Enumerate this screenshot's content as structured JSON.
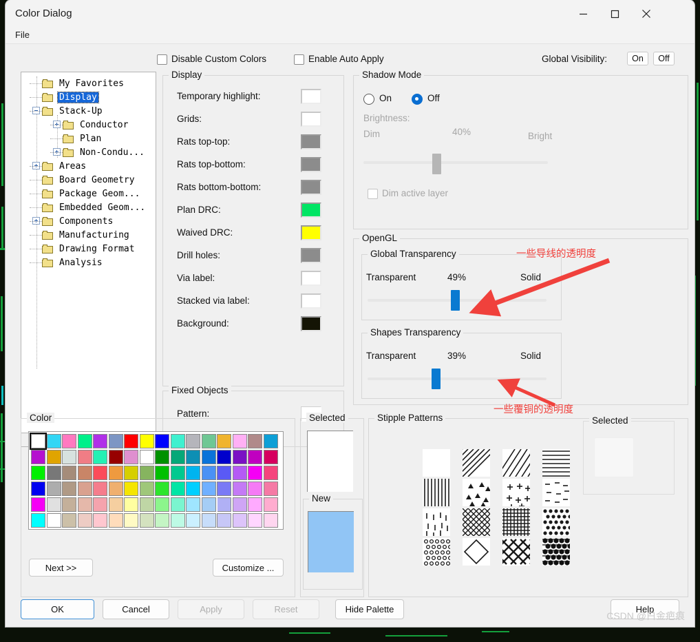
{
  "window": {
    "title": "Color Dialog",
    "controls": {
      "minimize": "minimize-icon",
      "maximize": "maximize-icon",
      "close": "close-icon"
    },
    "menu": [
      "File"
    ]
  },
  "top_options": {
    "disable_custom_colors": {
      "label": "Disable Custom Colors",
      "checked": false
    },
    "enable_auto_apply": {
      "label": "Enable Auto Apply",
      "checked": false
    },
    "global_visibility": {
      "label": "Global Visibility:",
      "on": "On",
      "off": "Off"
    }
  },
  "tree": {
    "items": [
      {
        "label": "My Favorites",
        "indent": 1,
        "expander": "",
        "selected": false
      },
      {
        "label": "Display",
        "indent": 1,
        "expander": "",
        "selected": true
      },
      {
        "label": "Stack-Up",
        "indent": 1,
        "expander": "minus",
        "selected": false
      },
      {
        "label": "Conductor",
        "indent": 2,
        "expander": "plus",
        "selected": false
      },
      {
        "label": "Plan",
        "indent": 2,
        "expander": "",
        "selected": false
      },
      {
        "label": "Non-Condu...",
        "indent": 2,
        "expander": "plus",
        "selected": false
      },
      {
        "label": "Areas",
        "indent": 1,
        "expander": "plus",
        "selected": false
      },
      {
        "label": "Board Geometry",
        "indent": 1,
        "expander": "",
        "selected": false
      },
      {
        "label": "Package Geom...",
        "indent": 1,
        "expander": "",
        "selected": false
      },
      {
        "label": "Embedded Geom...",
        "indent": 1,
        "expander": "",
        "selected": false
      },
      {
        "label": "Components",
        "indent": 1,
        "expander": "plus",
        "selected": false
      },
      {
        "label": "Manufacturing",
        "indent": 1,
        "expander": "",
        "selected": false
      },
      {
        "label": "Drawing Format",
        "indent": 1,
        "expander": "",
        "selected": false
      },
      {
        "label": "Analysis",
        "indent": 1,
        "expander": "",
        "selected": false
      }
    ]
  },
  "display_group": {
    "legend": "Display",
    "rows": [
      {
        "label": "Temporary highlight:",
        "color": "#ffffff"
      },
      {
        "label": "Grids:",
        "color": "#ffffff"
      },
      {
        "label": "Rats top-top:",
        "color": "#8c8c8c"
      },
      {
        "label": "Rats top-bottom:",
        "color": "#8c8c8c"
      },
      {
        "label": "Rats bottom-bottom:",
        "color": "#8c8c8c"
      },
      {
        "label": "Plan DRC:",
        "color": "#00e564"
      },
      {
        "label": "Waived DRC:",
        "color": "#ffff00"
      },
      {
        "label": "Drill holes:",
        "color": "#8c8c8c"
      },
      {
        "label": "Via label:",
        "color": "#ffffff"
      },
      {
        "label": "Stacked via label:",
        "color": "#ffffff"
      },
      {
        "label": "Background:",
        "color": "#141405"
      }
    ]
  },
  "fixed_objects": {
    "legend": "Fixed Objects",
    "rows": [
      {
        "label": "Pattern:",
        "color": "#ffffff"
      }
    ]
  },
  "shadow_mode": {
    "legend": "Shadow Mode",
    "on_label": "On",
    "off_label": "Off",
    "selected": "Off",
    "brightness_label": "Brightness:",
    "dim_label": "Dim",
    "bright_label": "Bright",
    "value_label": "40%",
    "value": 40,
    "dim_active_layer": {
      "label": "Dim active layer",
      "checked": false
    }
  },
  "opengl": {
    "legend": "OpenGL",
    "global_transparency": {
      "legend": "Global Transparency",
      "left_label": "Transparent",
      "right_label": "Solid",
      "value_label": "49%",
      "value": 49
    },
    "shapes_transparency": {
      "legend": "Shapes Transparency",
      "left_label": "Transparent",
      "right_label": "Solid",
      "value_label": "39%",
      "value": 39
    }
  },
  "color_section": {
    "legend": "Color",
    "next_button": "Next >>",
    "customize_button": "Customize ...",
    "selected_legend": "Selected",
    "new_legend": "New",
    "selected_color": "#ffffff",
    "new_color": "#91c5f5",
    "selected_index": 0,
    "light_selected_index": 75,
    "swatches": [
      "#ffffff",
      "#33d6f5",
      "#ff79c0",
      "#00f08a",
      "#b030e8",
      "#7d96c4",
      "#ff0000",
      "#ffff00",
      "#0000ff",
      "#3ff0cf",
      "#b5b5bb",
      "#6fc794",
      "#f0b42e",
      "#ffb0f5",
      "#b08a8a",
      "#0d9fd6",
      "#b511cf",
      "#e0a400",
      "#d7e2df",
      "#f07d85",
      "#25f0b4",
      "#970000",
      "#df8fcf",
      "#ffffff",
      "#009100",
      "#06a878",
      "#0d8fb4",
      "#0a73d9",
      "#0000cc",
      "#7a11c4",
      "#c000c0",
      "#d6005f",
      "#00f000",
      "#787878",
      "#a58c7a",
      "#c98567",
      "#fb4c5a",
      "#ef9a3f",
      "#d6cf00",
      "#86b45f",
      "#00c000",
      "#00c98f",
      "#00b4ef",
      "#4a91f5",
      "#5a5af5",
      "#b55af5",
      "#f500f5",
      "#f5457d",
      "#0000f0",
      "#adadad",
      "#b09a86",
      "#d9a18f",
      "#f57d8c",
      "#efb06f",
      "#f5e500",
      "#9fc77a",
      "#2de52d",
      "#00e5a5",
      "#00cfff",
      "#6fb0ff",
      "#7a7af5",
      "#c47af5",
      "#f57af5",
      "#f57aa5",
      "#f500f5",
      "#e0e0e0",
      "#c4b09a",
      "#e5b8aa",
      "#f5a3ad",
      "#f5cfa0",
      "#ffffa0",
      "#bfd6a5",
      "#8cf58c",
      "#7af5cf",
      "#9fe5ff",
      "#a5cdf5",
      "#b0b0f5",
      "#cfa5f5",
      "#ffaaff",
      "#ffaccf",
      "#00ffff",
      "#ffffff",
      "#ccc0a8",
      "#eeccc4",
      "#ffc7cf",
      "#ffdcbb",
      "#fffac4",
      "#d4e2bf",
      "#c4f5c4",
      "#bdfae5",
      "#cbf0ff",
      "#c7ddfa",
      "#c7c7f7",
      "#ddc4fa",
      "#ffd6ff",
      "#ffd6f0"
    ]
  },
  "stipple_section": {
    "legend": "Stipple Patterns",
    "selected_legend": "Selected",
    "selected_pattern": "blank",
    "patterns": [
      "blank",
      "diag-back",
      "diag-fwd",
      "horiz",
      "vert",
      "triangles",
      "plus",
      "dashes",
      "ticks",
      "cross-diag",
      "grid",
      "dots-diamond",
      "rings",
      "diamond-outline",
      "x-cross",
      "dense-dots"
    ]
  },
  "buttons": {
    "ok": "OK",
    "cancel": "Cancel",
    "apply": "Apply",
    "reset": "Reset",
    "hide_palette": "Hide Palette",
    "help": "Help"
  },
  "annotations": [
    {
      "text": "一些导线的透明度"
    },
    {
      "text": "一些覆铜的透明度"
    }
  ],
  "watermark": "CSDN @白金疤痕"
}
